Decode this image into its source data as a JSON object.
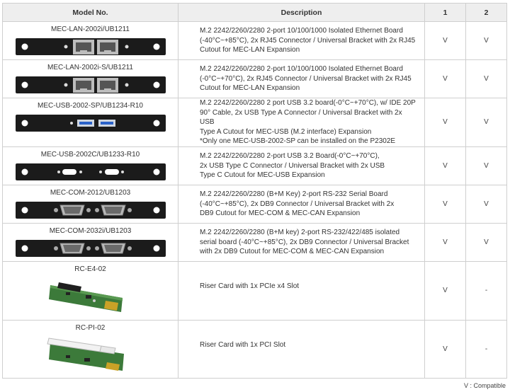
{
  "header": {
    "model": "Model No.",
    "description": "Description",
    "col1": "1",
    "col2": "2"
  },
  "rows": [
    {
      "model": "MEC-LAN-2002i/UB1211",
      "image": "bracket-2x-rj45",
      "description": "M.2 2242/2260/2280 2-port 10/100/1000 Isolated Ethernet Board\n(-40°C~+85°C), 2x RJ45 Connector / Universal Bracket with 2x RJ45\nCutout for MEC-LAN Expansion",
      "c1": "V",
      "c2": "V"
    },
    {
      "model": "MEC-LAN-2002i-S/UB1211",
      "image": "bracket-2x-rj45",
      "description": "M.2 2242/2260/2280 2-port 10/100/1000 Isolated Ethernet Board\n(-0°C~+70°C),  2x RJ45 Connector / Universal Bracket with 2x RJ45\nCutout for MEC-LAN Expansion",
      "c1": "V",
      "c2": "V"
    },
    {
      "model": "MEC-USB-2002-SP/UB1234-R10",
      "image": "bracket-2x-usb-a",
      "description": "M.2 2242/2260/2280 2 port USB 3.2 board(-0°C~+70°C),  w/ IDE 20P\n90° Cable, 2x USB Type A Connector / Universal Bracket with 2x USB\nType A Cutout for MEC-USB (M.2 interface) Expansion\n*Only one MEC-USB-2002-SP can be installed on the P2302E",
      "c1": "V",
      "c2": "V"
    },
    {
      "model": "MEC-USB-2002C/UB1233-R10",
      "image": "bracket-2x-usb-c",
      "description": "M.2 2242/2260/2280 2-port USB 3.2 Board(-0°C~+70°C),\n2x USB Type C Connector / Universal Bracket with 2x USB\nType C Cutout for MEC-USB Expansion",
      "c1": "V",
      "c2": "V"
    },
    {
      "model": "MEC-COM-2012/UB1203",
      "image": "bracket-2x-db9",
      "description": "M.2 2242/2260/2280 (B+M Key) 2-port RS-232 Serial Board\n(-40°C~+85°C), 2x DB9 Connector / Universal Bracket with 2x\nDB9 Cutout for MEC-COM & MEC-CAN Expansion",
      "c1": "V",
      "c2": "V"
    },
    {
      "model": "MEC-COM-2032i/UB1203",
      "image": "bracket-2x-db9",
      "description": "M.2 2242/2260/2280 (B+M key) 2-port RS-232/422/485 isolated\nserial board (-40°C~+85°C), 2x DB9 Connector / Universal Bracket\nwith 2x DB9 Cutout for MEC-COM & MEC-CAN Expansion",
      "c1": "V",
      "c2": "V"
    },
    {
      "model": "RC-E4-02",
      "image": "riser-card-pcie",
      "description": "Riser Card with 1x PCIe x4 Slot",
      "c1": "V",
      "c2": "-"
    },
    {
      "model": "RC-PI-02",
      "image": "riser-card-pci",
      "description": "Riser Card with 1x PCI Slot",
      "c1": "V",
      "c2": "-"
    }
  ],
  "footnote": "V : Compatible"
}
